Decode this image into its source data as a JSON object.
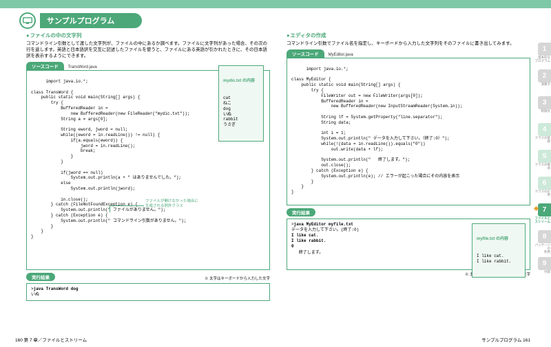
{
  "title": "サンプルプログラム",
  "left": {
    "heading": "ファイルの中の文字列",
    "lead": "コマンドライン引数として渡した文字列が、ファイルの中にあるか調べます。ファイルに文字列があった場合、その次の行を返します。英語と日本語訳を交互に記述したファイルを使うと、ファイルにある英語が引かれたときに、その日本語訳を表示するようにできます。",
    "src_label": "ソースコード",
    "src_file": "TransWord.java",
    "code": "import java.io.*;\n\nclass TransWord {\n    public static void main(String[] args) {\n        try {\n            BufferedReader in =\n                new BufferedReader(new FileReader(\"mydic.txt\"));\n            String a = args[0];\n\n            String eword, jword = null;\n            while((eword = in.readLine()) != null) {\n                if(a.equals(eword)) {\n                    jword = in.readLine();\n                    break;\n                }\n            }\n\n            if(jword == null)\n                System.out.println(a + \" はありませんでした。\");\n            else\n                System.out.println(jword);\n\n            in.close();\n        } catch (FileNotFoundException e) {\n            System.out.println(\" ファイルがありません。\");\n        } catch (Exception e) {\n            System.out.println(\" コマンドライン引数がありません。\");\n        }\n    }\n}",
    "mydic_title": "mydic.txt の内容",
    "mydic_body": "cat\nねこ\ndog\nいぬ\nrabbit\nうさぎ",
    "annotation": "ファイルが開けなかった場合に\n生成される例外クラス",
    "res_label": "実行結果",
    "note": "※ 太字はキーボードから入力した文字",
    "result": ">java TransWord dog\nいぬ",
    "result_bold": "java TransWord dog"
  },
  "right": {
    "heading": "エディタの作成",
    "lead": "コマンドライン引数でファイル名を指定し、キーボードから入力した文字列をそのファイルに書き出してみます。",
    "src_label": "ソースコード",
    "src_file": "MyEditor.java",
    "code": "import java.io.*;\n\nclass MyEditor {\n    public static void main(String[] args) {\n        try {\n            FileWriter out = new FileWriter(args[0]);\n            BufferedReader in =\n                new BufferedReader(new InputStreamReader(System.in));\n\n            String lf = System.getProperty(\"line.separator\");\n            String data;\n\n            int i = 1;\n            System.out.println(\" データを入力して下さい。（終了:0）\");\n            while(!(data = in.readLine()).equals(\"0\"))\n                out.write(data + lf);\n\n            System.out.println(\"   終了します。\");\n            out.close();\n        } catch (Exception e) {\n            System.out.println(e); // エラーが起こった場合にその内容を表示\n        }\n    }\n}",
    "res_label": "実行結果",
    "result": ">java MyEditor myfile.txt\nデータを入力して下さい。(終了:0)\nI like cat.\nI like rabbit.\n0\n   終了します。",
    "myfile_title": "myfile.txt の内容",
    "myfile_body": "I like cat.\nI like rabbit.",
    "note": "※ 太字はキーボードから入力した文字"
  },
  "footer": {
    "left": "160  第 7 章／ファイルとストリーム",
    "right": "サンプルプログラム  161"
  },
  "tabs": [
    {
      "num": "1",
      "label": "基本的な\nプログラム",
      "color": "#d6d6d6"
    },
    {
      "num": "2",
      "label": "演算子",
      "color": "#d6d6d6"
    },
    {
      "num": "3",
      "label": "制御文",
      "color": "#d6d6d6"
    },
    {
      "num": "4",
      "label": "クラスの基礎",
      "color": "#cde9da"
    },
    {
      "num": "5",
      "label": "クラスの継承",
      "color": "#cde9da"
    },
    {
      "num": "6",
      "label": "クラスの応用",
      "color": "#cde9da"
    },
    {
      "num": "7",
      "label": "ファイルと\nストリーム",
      "color": "#4ca879",
      "active": true
    },
    {
      "num": "8",
      "label": "パッケージの\n利用",
      "color": "#d6d6d6"
    },
    {
      "num": "9",
      "label": "付録",
      "color": "#d6d6d6"
    }
  ]
}
